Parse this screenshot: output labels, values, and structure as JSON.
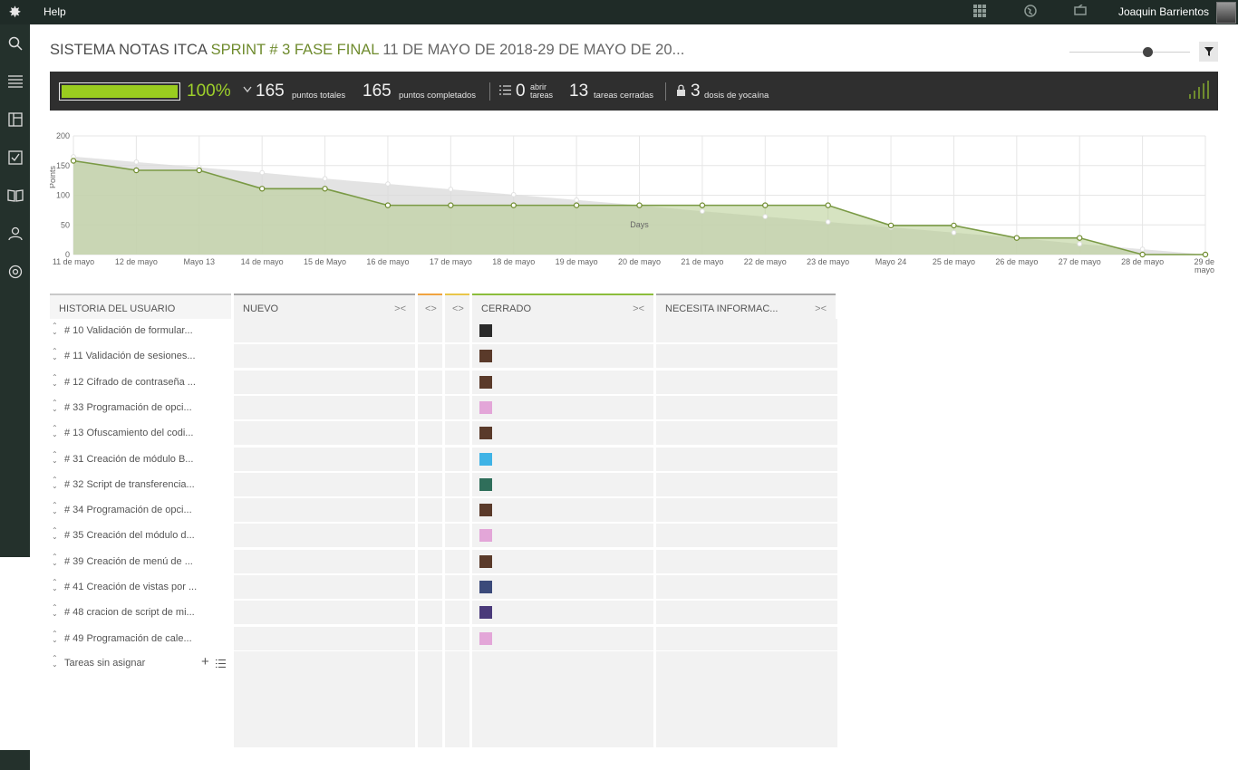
{
  "topbar": {
    "help": "Help",
    "user_name": "Joaquin Barrientos"
  },
  "header": {
    "project": "SISTEMA NOTAS ITCA",
    "sprint": "SPRINT # 3 FASE FINAL",
    "dates": "11 DE MAYO DE 2018-29 DE MAYO DE 20..."
  },
  "stats": {
    "progress_percent": 100,
    "percent_label": "100%",
    "total_points": "165",
    "total_points_label": "puntos totales",
    "completed_points": "165",
    "completed_points_label": "puntos completados",
    "open_tasks": "0",
    "open_tasks_label_1": "abrir",
    "open_tasks_label_2": "tareas",
    "closed_tasks": "13",
    "closed_tasks_label": "tareas cerradas",
    "iocaine": "3",
    "iocaine_label": "dosis de yocaína"
  },
  "chart_data": {
    "type": "area",
    "xlabel": "Days",
    "ylabel": "Points",
    "ylim": [
      0,
      200
    ],
    "yticks": [
      0,
      50,
      100,
      150,
      200
    ],
    "categories": [
      "11 de mayo",
      "12 de mayo",
      "Mayo 13",
      "14 de mayo",
      "15 de Mayo",
      "16 de mayo",
      "17 de mayo",
      "18 de mayo",
      "19 de mayo",
      "20 de mayo",
      "21 de mayo",
      "22 de mayo",
      "23 de mayo",
      "Mayo 24",
      "25 de mayo",
      "26 de mayo",
      "27 de mayo",
      "28 de mayo",
      "29 de mayo"
    ],
    "series": [
      {
        "values": [
          165,
          156,
          147,
          138,
          128,
          119,
          110,
          101,
          92,
          83,
          73,
          64,
          55,
          46,
          37,
          28,
          18,
          9,
          0
        ]
      },
      {
        "values": [
          158,
          142,
          142,
          111,
          111,
          83,
          83,
          83,
          83,
          83,
          83,
          83,
          83,
          49,
          49,
          28,
          28,
          0,
          0
        ]
      }
    ],
    "grid": true
  },
  "board": {
    "user_story_header": "HISTORIA DEL USUARIO",
    "columns": [
      {
        "name": "NUEVO",
        "color": "#a8a8a8"
      },
      {
        "name": "",
        "color": "#f0a340"
      },
      {
        "name": "",
        "color": "#e9c64a"
      },
      {
        "name": "CERRADO",
        "color": "#8cbd3c"
      },
      {
        "name": "NECESITA INFORMAC...",
        "color": "#a8a8a8"
      }
    ],
    "stories": [
      {
        "label": "# 10 Validación de formular...",
        "avatar": "#2b2b2b"
      },
      {
        "label": "# 11 Validación de sesiones...",
        "avatar": "#5a3a2a"
      },
      {
        "label": "# 12 Cifrado de contraseña ...",
        "avatar": "#5a3a2a"
      },
      {
        "label": "# 33 Programación de opci...",
        "avatar": "#e3a6d8"
      },
      {
        "label": "# 13 Ofuscamiento del codi...",
        "avatar": "#5a3a2a"
      },
      {
        "label": "# 31 Creación de módulo B...",
        "avatar": "#3fb3e6"
      },
      {
        "label": "# 32 Script de transferencia...",
        "avatar": "#2f6e5a"
      },
      {
        "label": "# 34 Programación de opci...",
        "avatar": "#5a3a2a"
      },
      {
        "label": "# 35 Creación del módulo d...",
        "avatar": "#e3a6d8"
      },
      {
        "label": "# 39 Creación de menú de ...",
        "avatar": "#5a3a2a"
      },
      {
        "label": "# 41 Creación de vistas por ...",
        "avatar": "#3b4a7a"
      },
      {
        "label": "# 48 cracion de script de mi...",
        "avatar": "#4a3a7a"
      },
      {
        "label": "# 49 Programación de cale...",
        "avatar": "#e3a6d8"
      }
    ],
    "unassigned_label": "Tareas sin asignar"
  }
}
